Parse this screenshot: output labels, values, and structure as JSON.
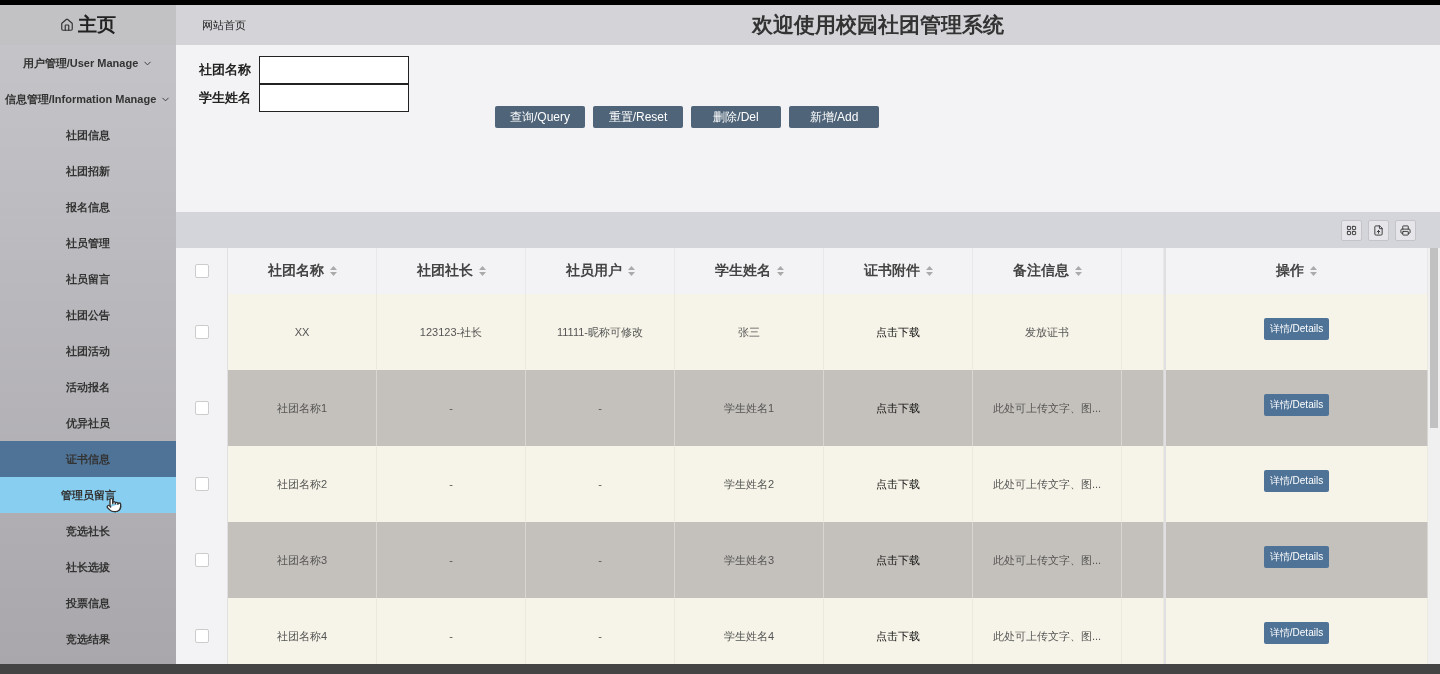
{
  "sidebar": {
    "title": "主页",
    "items": [
      {
        "label": "用户管理/User Manage",
        "kind": "group",
        "selected": false,
        "hovered": false
      },
      {
        "label": "信息管理/Information Manage",
        "kind": "group",
        "selected": false,
        "hovered": false
      },
      {
        "label": "社团信息",
        "kind": "link",
        "selected": false,
        "hovered": false
      },
      {
        "label": "社团招新",
        "kind": "link",
        "selected": false,
        "hovered": false
      },
      {
        "label": "报名信息",
        "kind": "link",
        "selected": false,
        "hovered": false
      },
      {
        "label": "社员管理",
        "kind": "link",
        "selected": false,
        "hovered": false
      },
      {
        "label": "社员留言",
        "kind": "link",
        "selected": false,
        "hovered": false
      },
      {
        "label": "社团公告",
        "kind": "link",
        "selected": false,
        "hovered": false
      },
      {
        "label": "社团活动",
        "kind": "link",
        "selected": false,
        "hovered": false
      },
      {
        "label": "活动报名",
        "kind": "link",
        "selected": false,
        "hovered": false
      },
      {
        "label": "优异社员",
        "kind": "link",
        "selected": false,
        "hovered": false
      },
      {
        "label": "证书信息",
        "kind": "link",
        "selected": true,
        "hovered": false
      },
      {
        "label": "管理员留言",
        "kind": "link",
        "selected": false,
        "hovered": true
      },
      {
        "label": "竞选社长",
        "kind": "link",
        "selected": false,
        "hovered": false
      },
      {
        "label": "社长选拔",
        "kind": "link",
        "selected": false,
        "hovered": false
      },
      {
        "label": "投票信息",
        "kind": "link",
        "selected": false,
        "hovered": false
      },
      {
        "label": "竞选结果",
        "kind": "link",
        "selected": false,
        "hovered": false
      }
    ]
  },
  "header": {
    "breadcrumb": "网站首页",
    "title": "欢迎使用校园社团管理系统"
  },
  "search": {
    "fields": [
      {
        "label": "社团名称"
      },
      {
        "label": "学生姓名"
      }
    ],
    "buttons": [
      "查询/Query",
      "重置/Reset",
      "删除/Del",
      "新增/Add"
    ]
  },
  "table": {
    "select_all_checked": false,
    "columns": [
      "社团名称",
      "社团社长",
      "社员用户",
      "学生姓名",
      "证书附件",
      "备注信息",
      "",
      "操作"
    ],
    "rows": [
      {
        "checked": false,
        "cells": [
          "XX",
          "123123-社长",
          "11111-昵称可修改",
          "张三",
          "点击下载",
          "发放证书"
        ],
        "action": "详情/Details"
      },
      {
        "checked": false,
        "cells": [
          "社团名称1",
          "-",
          "-",
          "学生姓名1",
          "点击下载",
          "此处可上传文字、图..."
        ],
        "action": "详情/Details"
      },
      {
        "checked": false,
        "cells": [
          "社团名称2",
          "-",
          "-",
          "学生姓名2",
          "点击下载",
          "此处可上传文字、图..."
        ],
        "action": "详情/Details"
      },
      {
        "checked": false,
        "cells": [
          "社团名称3",
          "-",
          "-",
          "学生姓名3",
          "点击下载",
          "此处可上传文字、图..."
        ],
        "action": "详情/Details"
      },
      {
        "checked": false,
        "cells": [
          "社团名称4",
          "-",
          "-",
          "学生姓名4",
          "点击下载",
          "此处可上传文字、图..."
        ],
        "action": "详情/Details"
      }
    ]
  }
}
